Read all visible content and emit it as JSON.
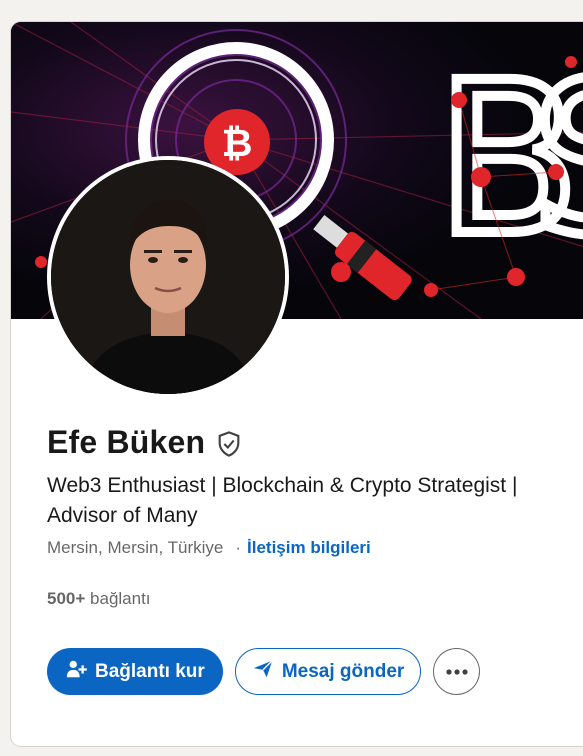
{
  "profile": {
    "name": "Efe Büken",
    "headline": "Web3 Enthusiast | Blockchain & Crypto Strategist |\nAdvisor of Many",
    "location": "Mersin, Mersin, Türkiye",
    "separator": "·",
    "contact_link": "İletişim bilgileri",
    "connections_count": "500+",
    "connections_label": "bağlantı",
    "verified": true
  },
  "cover": {
    "text": "OBSE",
    "icon": "bitcoin-icon"
  },
  "actions": {
    "connect_label": "Bağlantı kur",
    "connect_icon": "add-person-icon",
    "message_label": "Mesaj gönder",
    "message_icon": "send-icon",
    "more_icon": "more-icon"
  },
  "colors": {
    "primary": "#0a66c2",
    "cover_accent": "#e0262a"
  }
}
